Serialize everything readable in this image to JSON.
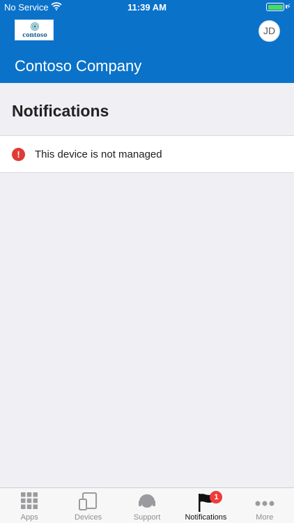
{
  "status_bar": {
    "carrier": "No Service",
    "time": "11:39 AM",
    "battery_level": 1.0
  },
  "header": {
    "logo_text": "contoso",
    "avatar_initials": "JD",
    "company_name": "Contoso Company"
  },
  "page": {
    "title": "Notifications"
  },
  "notifications": [
    {
      "icon": "alert-icon",
      "text": "This device is not managed"
    }
  ],
  "tab_bar": {
    "tabs": [
      {
        "label": "Apps",
        "icon": "apps-grid-icon",
        "active": false
      },
      {
        "label": "Devices",
        "icon": "devices-icon",
        "active": false
      },
      {
        "label": "Support",
        "icon": "headset-icon",
        "active": false
      },
      {
        "label": "Notifications",
        "icon": "flag-icon",
        "active": true,
        "badge": "1"
      },
      {
        "label": "More",
        "icon": "more-dots-icon",
        "active": false
      }
    ]
  },
  "colors": {
    "header_blue": "#0a72c9",
    "alert_red": "#e03b35",
    "badge_red": "#ef3b3b",
    "background": "#efeff4",
    "battery_green": "#4cd964"
  }
}
